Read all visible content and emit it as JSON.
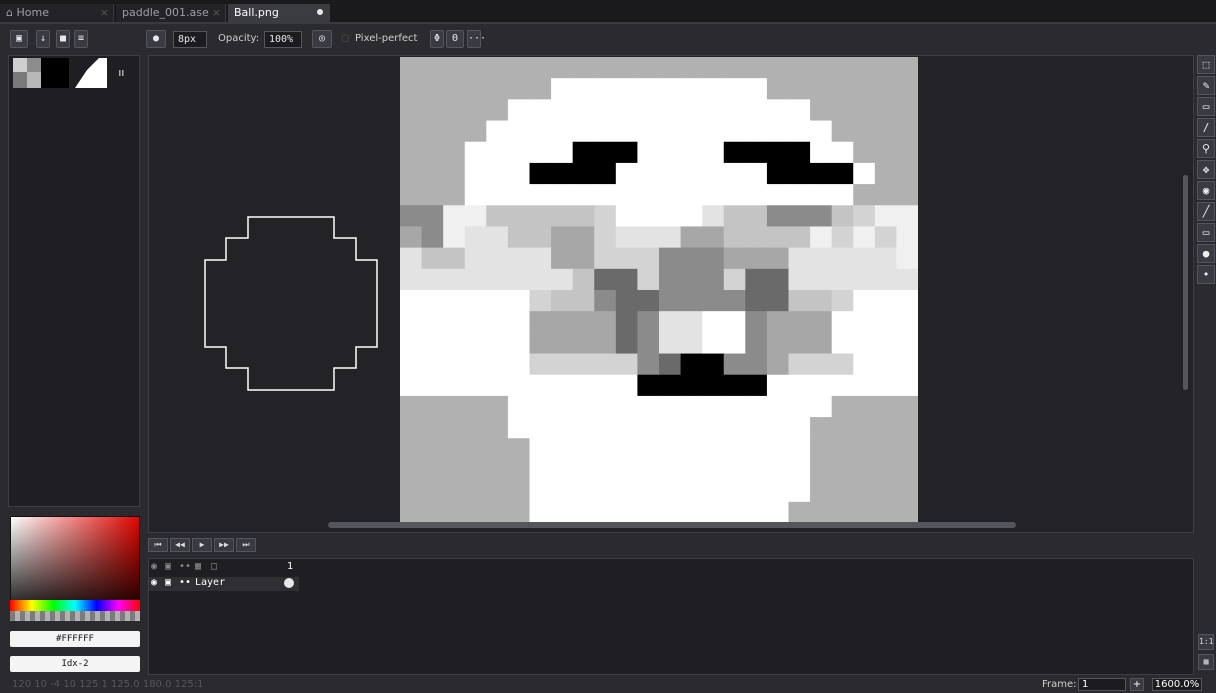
{
  "tabs": [
    {
      "label": "Home",
      "icon": "home-icon"
    },
    {
      "label": "paddle_001.ase"
    },
    {
      "label": "Ball.png",
      "active": true
    }
  ],
  "toolbar": {
    "brush_size": "8px",
    "opacity_label": "Opacity:",
    "opacity_value": "100%",
    "pixel_perfect_label": "Pixel-perfect",
    "more_label": "···"
  },
  "colors": {
    "primary_hex": "#FFFFFF",
    "index_label": "Idx-2",
    "picker_hue": "#e10600"
  },
  "palette": [
    "#ffffff",
    "#e0e0e0",
    "#a9a9a9",
    "#7a7a7a",
    "#000000"
  ],
  "timeline": {
    "frame_number": "1",
    "layer_name": "Layer"
  },
  "status": {
    "coords": "120 10  -4 10  125 1  125.0  180.0  125:1",
    "frame_label": "Frame:",
    "frame_value": "1",
    "zoom": "1600.0%"
  },
  "sprite": {
    "palette": {
      "0": "#b1b1b1",
      "1": "#ffffff",
      "2": "#e3e3e3",
      "3": "#c4c4c4",
      "4": "#a7a7a7",
      "5": "#8b8b8b",
      "6": "#6a6a6a",
      "7": "#000000",
      "8": "#f0f0f0",
      "9": "#d3d3d3"
    },
    "rows": [
      "000000000000000000000000",
      "000000011111111110000000",
      "000001111111111111100000",
      "000011111111111111110000",
      "000111117771111777711000",
      "000111777711111117777100",
      "000111111111111111111000",
      "558833333911112335553988",
      "458223344922244333389898",
      "233222244999555444222228",
      "222222223669555966222222",
      "111111933566555566339111",
      "111111444465221154441111",
      "111111444465221154441111",
      "111111999995677554999111",
      "111111111117777771111111",
      "000001111111111111110000",
      "000001111111111111100000",
      "000000111111111111100000",
      "000000111111111111100000",
      "000000111111111111100000",
      "000000111111111111000000"
    ]
  }
}
